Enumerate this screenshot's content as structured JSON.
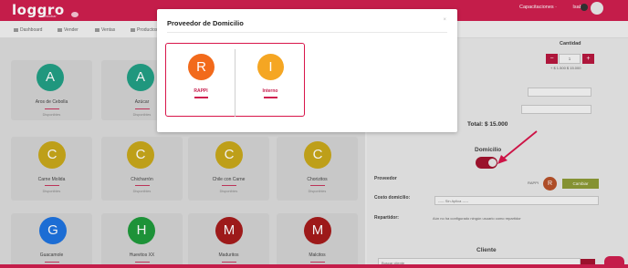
{
  "app": {
    "logo": "loggro",
    "logo_sub": "restobar",
    "top_link": "Capacitaciones ·",
    "user_name": "Isabel"
  },
  "nav": {
    "items": [
      "Dashboard",
      "Vender",
      "Ventas",
      "Productos"
    ]
  },
  "products": [
    {
      "name": "Aros de Cebolla",
      "letter": "A",
      "stock": "Disponibles"
    },
    {
      "name": "Azúcar",
      "letter": "A",
      "stock": "Disponibles"
    },
    {
      "name": "Carne Molida",
      "letter": "C",
      "stock": "Disponibles"
    },
    {
      "name": "Chicharrón",
      "letter": "C",
      "stock": "Disponibles"
    },
    {
      "name": "Chile con Carne",
      "letter": "C",
      "stock": "Disponibles"
    },
    {
      "name": "Chorizitos",
      "letter": "C",
      "stock": "Disponibles"
    },
    {
      "name": "Guacamole",
      "letter": "G",
      "stock": ""
    },
    {
      "name": "Huevitos XX",
      "letter": "H",
      "stock": ""
    },
    {
      "name": "Maduritos",
      "letter": "M",
      "stock": ""
    },
    {
      "name": "Malcitos",
      "letter": "M",
      "stock": ""
    }
  ],
  "colors": {
    "brand": "#cf1f4f",
    "aqua": "#22a085",
    "yellow": "#c9a81b",
    "blue": "#1e73e0",
    "green": "#1f9a3b",
    "maroon": "#a61c1c",
    "orange": "#f26a1b",
    "amber": "#f5a623"
  },
  "order_panel": {
    "qty_label": "Cantidad",
    "minus": "−",
    "plus": "+",
    "qty_value": "1",
    "price_line": "+ $ 1.500   $ 15.000",
    "total": "Total: $ 15.000",
    "delivery_label": "Domicilio",
    "provider_label": "Proveedor",
    "provider_name": "RAPPI",
    "provider_letter": "R",
    "change_button": "Cambiar",
    "cost_label": "Costo domicilio:",
    "cost_select": "----- Sin Aplica -----",
    "delivery_person_label": "Repartidor:",
    "delivery_person_text": "Aún no ha configurado ningún usuario como repartidor",
    "client_label": "Cliente",
    "client_search_placeholder": "Buscar cliente"
  },
  "modal": {
    "title": "Proveedor de Domicilio",
    "close": "×",
    "providers": [
      {
        "letter": "R",
        "name": "RAPPI"
      },
      {
        "letter": "I",
        "name": "Interno"
      }
    ]
  }
}
